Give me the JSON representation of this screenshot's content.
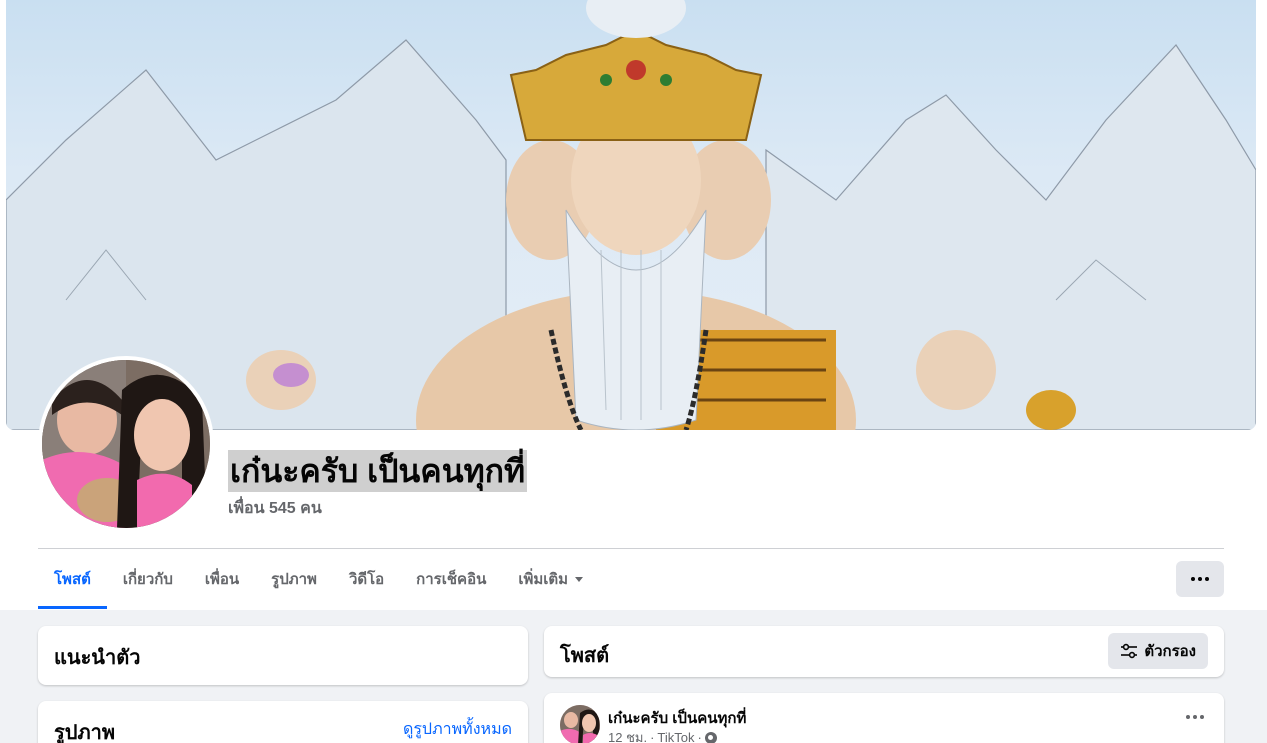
{
  "profile": {
    "name": "เก๋นะครับ เป็นคนทุกที่",
    "friends": "เพื่อน 545 คน"
  },
  "tabs": [
    {
      "label": "โพสต์",
      "active": true
    },
    {
      "label": "เกี่ยวกับ",
      "active": false
    },
    {
      "label": "เพื่อน",
      "active": false
    },
    {
      "label": "รูปภาพ",
      "active": false
    },
    {
      "label": "วิดีโอ",
      "active": false
    },
    {
      "label": "การเช็คอิน",
      "active": false
    },
    {
      "label": "เพิ่มเติม",
      "active": false
    }
  ],
  "intro": {
    "title": "แนะนำตัว"
  },
  "photos": {
    "title": "รูปภาพ",
    "link": "ดูรูปภาพทั้งหมด"
  },
  "posts": {
    "title": "โพสต์",
    "filter_label": "ตัวกรอง"
  },
  "post": {
    "author": "เก๋นะครับ เป็นคนทุกที่",
    "time": "12 ชม.",
    "source": "TikTok",
    "separator": "·"
  },
  "colors": {
    "accent": "#0866ff",
    "secondary_text": "#65676b",
    "page_bg": "#f0f2f5"
  }
}
